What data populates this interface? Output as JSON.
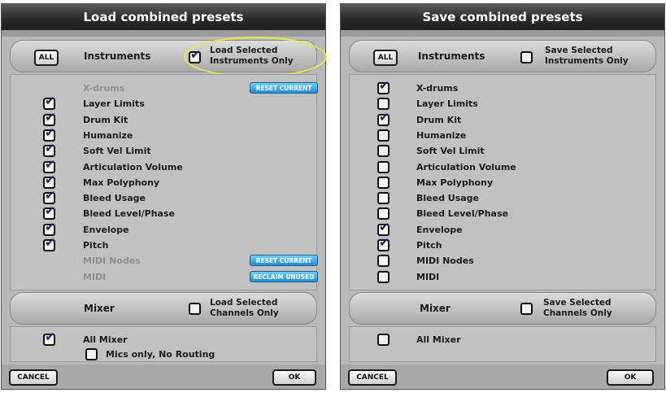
{
  "load": {
    "title": "Load combined presets",
    "all_label": "ALL",
    "instruments_label": "Instruments",
    "selected_label": "Load Selected\nInstruments Only",
    "selected_checked": true,
    "items": [
      {
        "label": "X-drums",
        "checked": null,
        "enabled": false,
        "action": "RESET CURRENT"
      },
      {
        "label": "Layer Limits",
        "checked": true,
        "enabled": true
      },
      {
        "label": "Drum Kit",
        "checked": true,
        "enabled": true
      },
      {
        "label": "Humanize",
        "checked": true,
        "enabled": true
      },
      {
        "label": "Soft Vel Limit",
        "checked": true,
        "enabled": true
      },
      {
        "label": "Articulation Volume",
        "checked": true,
        "enabled": true
      },
      {
        "label": "Max Polyphony",
        "checked": true,
        "enabled": true
      },
      {
        "label": "Bleed Usage",
        "checked": true,
        "enabled": true
      },
      {
        "label": "Bleed Level/Phase",
        "checked": true,
        "enabled": true
      },
      {
        "label": "Envelope",
        "checked": true,
        "enabled": true
      },
      {
        "label": "Pitch",
        "checked": true,
        "enabled": true
      },
      {
        "label": "MIDI Nodes",
        "checked": null,
        "enabled": false,
        "action": "RESET CURRENT"
      },
      {
        "label": "MIDI",
        "checked": null,
        "enabled": false,
        "action": "RECLAIM UNUSED"
      }
    ],
    "mixer_label": "Mixer",
    "mixer_selected_label": "Load Selected\nChannels Only",
    "mixer_selected_checked": false,
    "all_mixer_label": "All Mixer",
    "all_mixer_checked": true,
    "mics_only_label": "Mics only, No Routing",
    "mics_only_checked": false,
    "cancel_label": "CANCEL",
    "ok_label": "OK",
    "highlight_color": "#e8e84a"
  },
  "save": {
    "title": "Save combined presets",
    "all_label": "ALL",
    "instruments_label": "Instruments",
    "selected_label": "Save Selected\nInstruments Only",
    "selected_checked": false,
    "items": [
      {
        "label": "X-drums",
        "checked": true,
        "enabled": true
      },
      {
        "label": "Layer Limits",
        "checked": false,
        "enabled": true
      },
      {
        "label": "Drum Kit",
        "checked": true,
        "enabled": true
      },
      {
        "label": "Humanize",
        "checked": false,
        "enabled": true
      },
      {
        "label": "Soft Vel Limit",
        "checked": false,
        "enabled": true
      },
      {
        "label": "Articulation Volume",
        "checked": false,
        "enabled": true
      },
      {
        "label": "Max Polyphony",
        "checked": false,
        "enabled": true
      },
      {
        "label": "Bleed Usage",
        "checked": false,
        "enabled": true
      },
      {
        "label": "Bleed Level/Phase",
        "checked": false,
        "enabled": true
      },
      {
        "label": "Envelope",
        "checked": true,
        "enabled": true
      },
      {
        "label": "Pitch",
        "checked": true,
        "enabled": true
      },
      {
        "label": "MIDI Nodes",
        "checked": false,
        "enabled": true
      },
      {
        "label": "MIDI",
        "checked": false,
        "enabled": true
      }
    ],
    "mixer_label": "Mixer",
    "mixer_selected_label": "Save Selected\nChannels Only",
    "mixer_selected_checked": false,
    "all_mixer_label": "All Mixer",
    "all_mixer_checked": false,
    "cancel_label": "CANCEL",
    "ok_label": "OK"
  }
}
